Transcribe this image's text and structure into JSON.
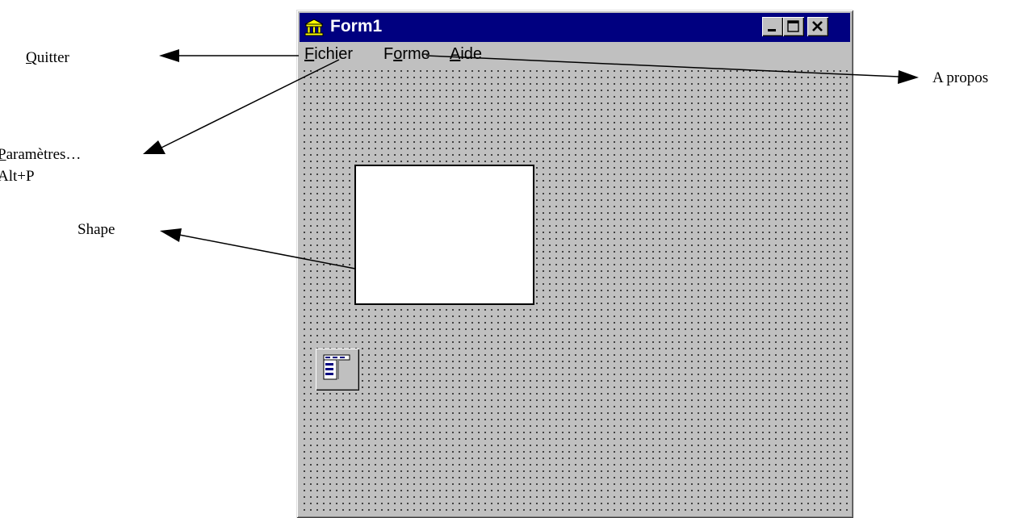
{
  "annotations": {
    "quitter": {
      "underlined": "Q",
      "rest": "uitter"
    },
    "parametres": {
      "underlined": "P",
      "rest": "aramètres…"
    },
    "shortcut": "Alt+P",
    "shape": "Shape",
    "apropos": "A propos"
  },
  "window": {
    "title": "Form1",
    "icon": "app-icon"
  },
  "menu": [
    {
      "label": "Fichier",
      "mnemonic": "F"
    },
    {
      "label": "Forme",
      "mnemonic": "o"
    },
    {
      "label": "Aide",
      "mnemonic": "A"
    }
  ],
  "form": {
    "shape": "shape-rectangle",
    "component_icon": "main-menu-component-icon"
  },
  "colors": {
    "titlebar": "#000080",
    "face": "#c0c0c0"
  }
}
